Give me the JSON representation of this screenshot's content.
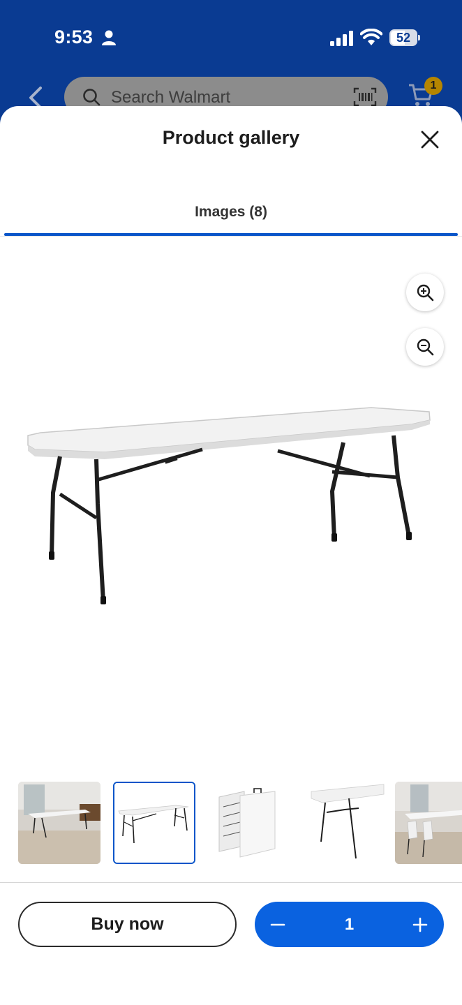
{
  "status_bar": {
    "time": "9:53",
    "battery": "52",
    "icons": [
      "person-icon",
      "cellular-signal-icon",
      "wifi-icon",
      "battery-icon"
    ]
  },
  "header": {
    "search_placeholder": "Search Walmart",
    "cart_count": "1",
    "colors": {
      "background": "#0a3b92",
      "badge": "#b58500"
    }
  },
  "gallery": {
    "title": "Product gallery",
    "tab_label": "Images (8)",
    "thumbnails": [
      {
        "name": "thumbnail-room-scene",
        "selected": false
      },
      {
        "name": "thumbnail-table-white",
        "selected": true
      },
      {
        "name": "thumbnail-folded-table",
        "selected": false
      },
      {
        "name": "thumbnail-table-angle",
        "selected": false
      },
      {
        "name": "thumbnail-table-with-chairs",
        "selected": false
      }
    ]
  },
  "actions": {
    "buy_now_label": "Buy now",
    "quantity": "1",
    "colors": {
      "primary": "#0a62e0",
      "accent": "#0a55c9"
    }
  }
}
